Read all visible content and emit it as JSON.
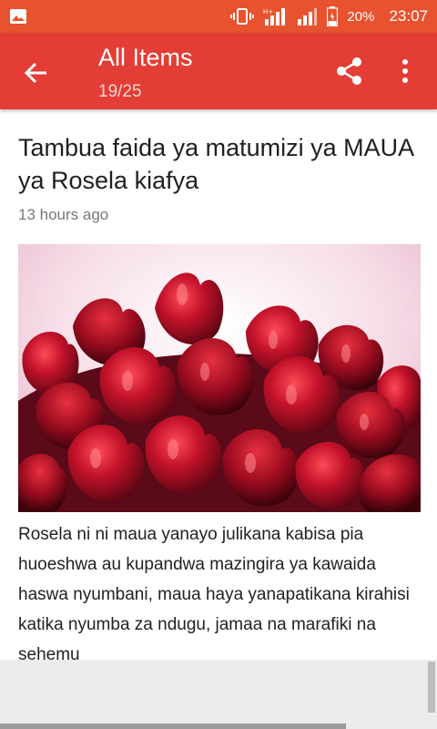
{
  "status": {
    "battery_percent": "20%",
    "time": "23:07",
    "icons": [
      "gallery-icon",
      "vibrate-icon",
      "signal-icon",
      "signal-icon",
      "battery-icon"
    ]
  },
  "app_bar": {
    "title": "All Items",
    "position": "19/25",
    "colors": {
      "bar": "#e33d35",
      "status": "#e8522e"
    }
  },
  "article": {
    "title": "Tambua faida ya matumizi ya MAUA ya Rosela kiafya",
    "time_ago": "13 hours ago",
    "body": "Rosela ni ni maua yanayo julikana kabisa pia  huoeshwa au kupandwa mazingira ya kawaida haswa nyumbani, maua haya yanapatikana kirahisi katika nyumba za ndugu, jamaa na marafiki na sehemu"
  }
}
